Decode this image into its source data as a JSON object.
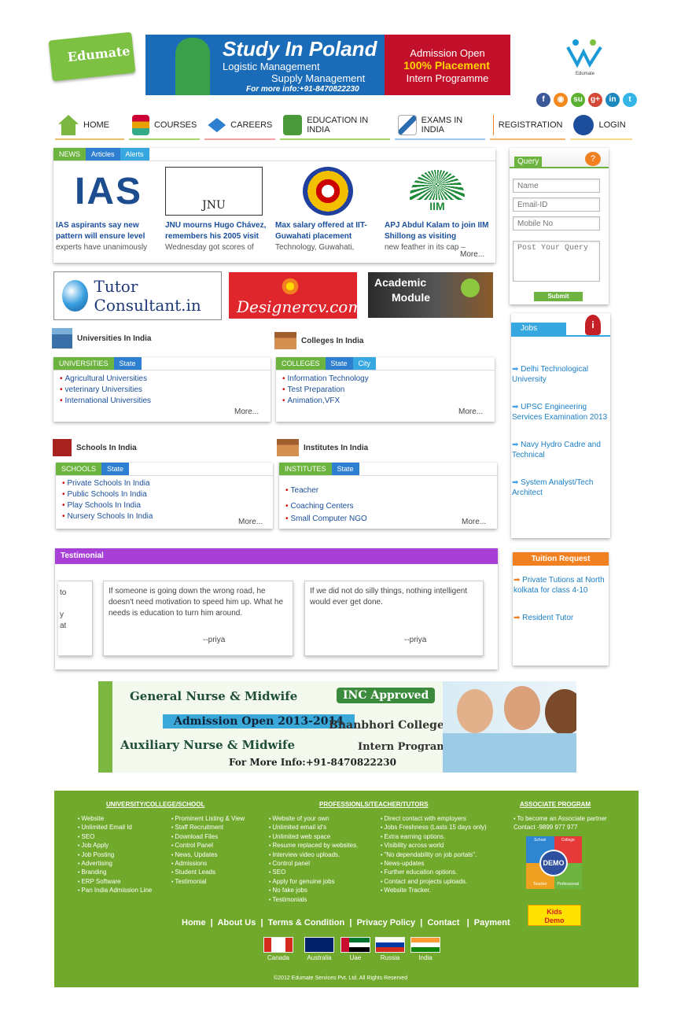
{
  "header": {
    "logo_text": "Edumate",
    "right_logo_caption": "Edumate",
    "banner": {
      "title": "Study In Poland",
      "line1": "Logistic Management",
      "line2": "Supply Management",
      "info": "For more info:+91-8470822230",
      "r1": "Admission Open",
      "r2": "100% Placement",
      "r3": "Intern Programme"
    },
    "social": [
      "f",
      "rss",
      "su",
      "g+",
      "in",
      "t"
    ]
  },
  "nav": [
    "HOME",
    "COURSES",
    "CAREERS",
    "EDUCATION IN INDIA",
    "EXAMS IN INDIA",
    "REGISTRATION",
    "LOGIN"
  ],
  "news": {
    "tabs": [
      "NEWS",
      "Articles",
      "Alerts"
    ],
    "items": [
      {
        "img": "IAS",
        "headline": "IAS aspirants say new pattern will ensure level",
        "desc": "experts have unanimously"
      },
      {
        "img": "JNU",
        "headline": "JNU mourns Hugo Chávez, remembers his 2005 visit",
        "desc": "Wednesday got scores of"
      },
      {
        "img": "",
        "headline": "Max salary offered at IIT-Guwahati placement",
        "desc": "Technology, Guwahati,"
      },
      {
        "img": "IIM",
        "headline": "APJ Abdul Kalam to join IIM Shillong as visiting",
        "desc": "new feather in its cap –"
      }
    ],
    "more": "More..."
  },
  "ads": {
    "tutor": "Tutor Consultant.in",
    "designer": "Designercv.com",
    "academic_1": "Academic",
    "academic_2": "Module"
  },
  "query": {
    "title": "Query",
    "name": "Name",
    "email": "Email-ID",
    "mobile": "Mobile No",
    "post": "Post Your Query",
    "submit": "Submit"
  },
  "universities": {
    "title": "Universities In India",
    "tabs": [
      "UNIVERSITIES",
      "State"
    ],
    "items": [
      "Agricultural Universities",
      "veterinary Universities",
      "International Universities"
    ],
    "more": "More..."
  },
  "colleges": {
    "title": "Colleges In India",
    "tabs": [
      "COLLEGES",
      "State",
      "City"
    ],
    "items": [
      "Information Technology",
      "Test Preparation",
      "Animation,VFX"
    ],
    "more": "More..."
  },
  "schools": {
    "title": "Schools In India",
    "tabs": [
      "SCHOOLS",
      "State"
    ],
    "items": [
      "Private Schools In India",
      "Public Schools In India",
      "Play Schools In India",
      "Nursery Schools In India"
    ],
    "more": "More..."
  },
  "institutes": {
    "title": "Institutes In India",
    "tabs": [
      "INSTITUTES",
      "State"
    ],
    "items": [
      "Teacher",
      "Coaching Centers",
      "Small Computer NGO"
    ],
    "more": "More..."
  },
  "jobs": {
    "title": "Jobs",
    "items": [
      "Delhi Technological University",
      "UPSC Engineering Services Examination 2013",
      "Navy Hydro Cadre and Technical",
      "System Analyst/Tech Architect"
    ]
  },
  "testimonial": {
    "title": "Testimonial",
    "partial": [
      "to",
      "y",
      "at"
    ],
    "cards": [
      {
        "text": "If someone is going down the wrong road, he doesn't need motivation to speed him up. What he needs is education to turn him around.",
        "author": "--priya"
      },
      {
        "text": "If we did not do silly things, nothing intelligent would ever get done.",
        "author": "--priya"
      }
    ]
  },
  "tuition": {
    "title": "Tuition Request",
    "items": [
      "Private Tutions at North kolkata for class 4-10",
      "Resident Tutor"
    ]
  },
  "nurse_banner": {
    "l1": "General Nurse & Midwife",
    "l2": "INC Approved",
    "l3": "Admission Open 2013-2014",
    "l4": "Bhanbhori College",
    "l5": "Auxiliary Nurse & Midwife",
    "l6": "Intern Program",
    "l7": "For More Info:+91-8470822230"
  },
  "footer": {
    "col1_title": "UNIVERSITY/COLLEGE/SCHOOL",
    "col1a": [
      "Website",
      "Unlimited Email Id",
      "SEO",
      "Job Apply",
      "Job Posting",
      "Advertising",
      "Branding",
      "ERP Software",
      "Pan India Admission Line"
    ],
    "col1b": [
      "Prominent Listing & View",
      "Staff Recruitment",
      "Download Files",
      "Control Panel",
      "News, Updates",
      "Admissions",
      "Student Leads",
      "Testimonial"
    ],
    "col2_title": "PROFESSIONLS/TEACHER/TUTORS",
    "col2a": [
      "Website of your own",
      "Unlimited email id's",
      "Unlimited web space",
      "Resume replaced by websites.",
      "Interview video uploads.",
      "Control panel",
      "SEO",
      "Apply for genuine jobs",
      "No fake jobs",
      "Testimonials"
    ],
    "col2b": [
      "Direct contact with employers",
      "Jobs Freshness (Lasts 15 days only)",
      "Extra earning options.",
      "Visibility across world",
      "\"No dependability on job portals\".",
      "News-updates",
      "Further education options.",
      "Contact and projects uploads.",
      "Website Tracker."
    ],
    "col3_title": "ASSOCIATE PROGRAM",
    "col3": [
      "To become an Associate partner Contact -9899 977 977"
    ],
    "demo": "DEMO",
    "demo_labels": [
      "School",
      "College",
      "Teacher",
      "Professional"
    ],
    "kids_demo": "Kids Demo",
    "links": [
      "Home",
      "About Us",
      "Terms & Condition",
      "Privacy Policy",
      "Contact",
      "Payment"
    ],
    "flags": [
      "Canada",
      "Australia",
      "Uae",
      "Russia",
      "India"
    ],
    "copyright": "©2012 Edumate Services Pvt. Ltd. All Rights Reserved"
  }
}
